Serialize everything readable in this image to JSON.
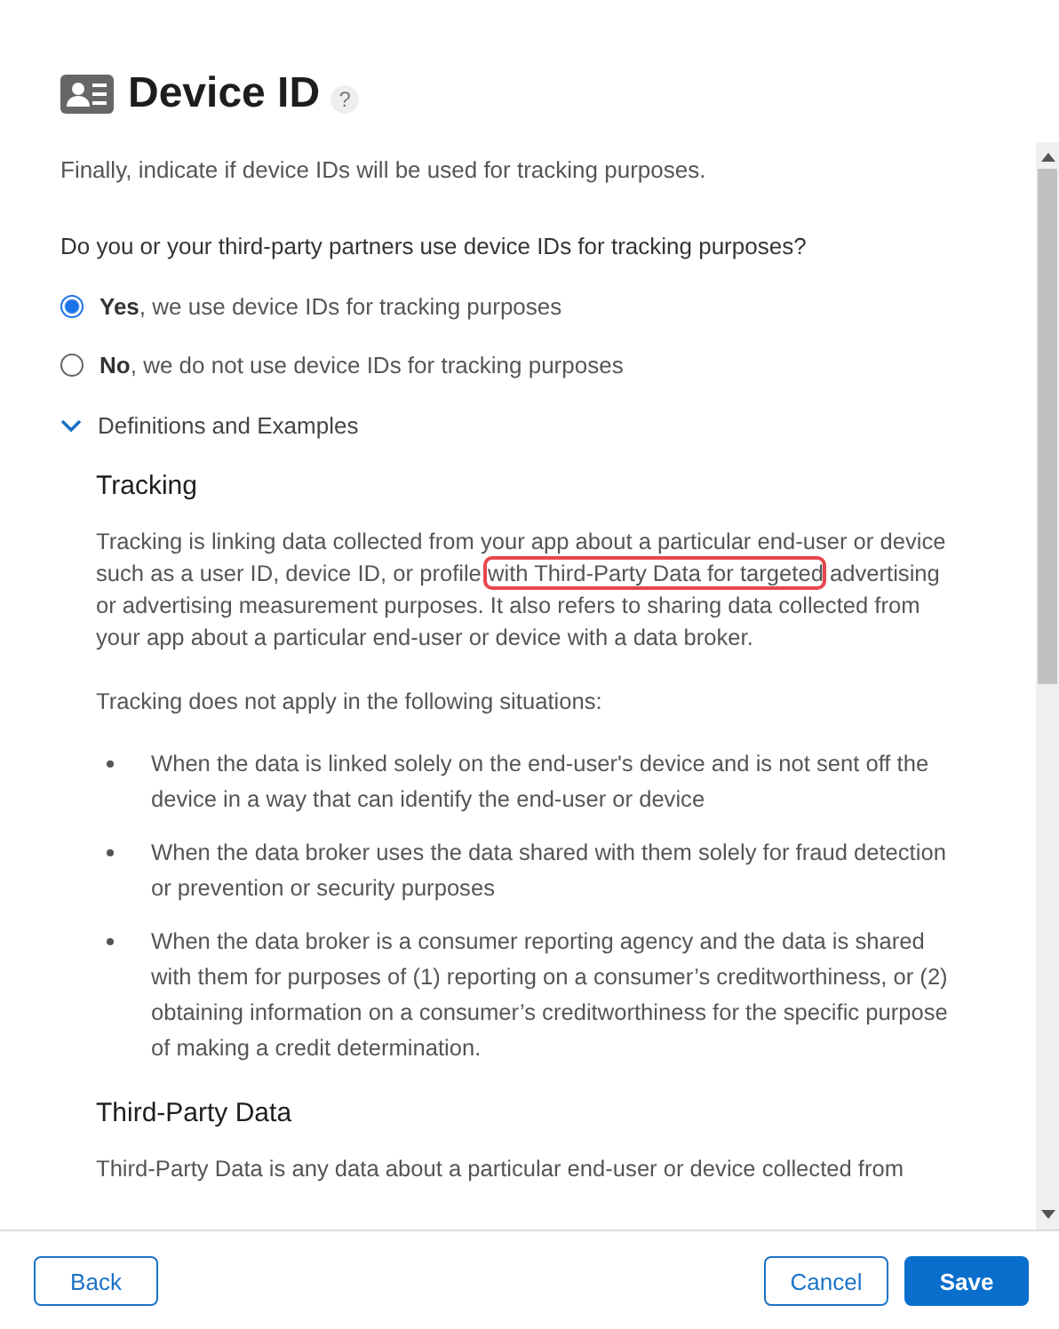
{
  "title": "Device ID",
  "help": "?",
  "intro": "Finally, indicate if device IDs will be used for tracking purposes.",
  "question": "Do you or your third-party partners use device IDs for tracking purposes?",
  "options": [
    {
      "label": "**Yes**, we use device IDs for tracking purposes",
      "selected": true
    },
    {
      "label": "**No**, we do not use device IDs for tracking purposes",
      "selected": false
    }
  ],
  "disclosure": {
    "label": "Definitions and Examples",
    "expanded": true
  },
  "sections": [
    {
      "heading": "Tracking",
      "paragraphs": [
        {
          "before": "Tracking is linking data collected from your app about a particular end-user or device such as a user ID, device ID, or profile ",
          "highlighted": "with Third-Party Data for targeted",
          "after": " advertising or advertising measurement purposes. It also refers to sharing data collected from your app about a particular end-user or device with a data broker."
        },
        {
          "before": "Tracking does not apply in the following situations:"
        }
      ],
      "bullets": [
        "When the data is linked solely on the end-user's device and is not sent off the device in a way that can identify the end-user or device",
        "When the data broker uses the data shared with them solely for fraud detection or prevention or security purposes",
        "When the data broker is a consumer reporting agency and the data is shared with them for purposes of (1) reporting on a consumer’s creditworthiness, or (2) obtaining information on a consumer’s creditworthiness for the specific purpose of making a credit determination."
      ]
    },
    {
      "heading": "Third-Party Data",
      "paragraphs": [
        {
          "before": "Third-Party Data is any data about a particular end-user or device collected from"
        }
      ]
    }
  ],
  "buttons": {
    "back": "Back",
    "cancel": "Cancel",
    "save": "Save"
  }
}
